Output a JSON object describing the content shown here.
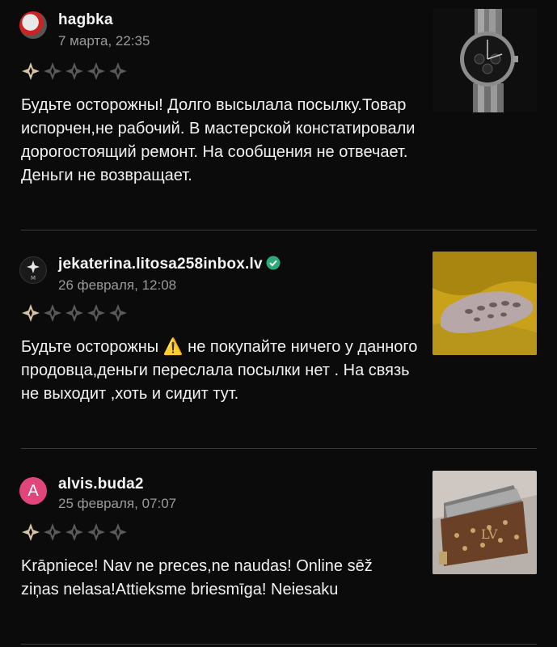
{
  "reviews": [
    {
      "username": "hagbka",
      "date": "7 марта, 22:35",
      "rating": 1,
      "text": "Будьте осторожны! Долго высылала посылку.Товар испорчен,не рабочий. В мастерской констатировали дорогостоящий ремонт. На сообщения не отвечает. Деньги не возвращает.",
      "photo": "watch-photo"
    },
    {
      "username": "jekaterina.litosa258inbox.lv",
      "date": "26 февраля, 12:08",
      "rating": 1,
      "text": "Будьте осторожны ⚠️ не покупайте ничего у данного продовца,деньги переслала посылки нет . На связь не выходит ,хоть и сидит тут.",
      "photo": "sneaker-photo",
      "verified": true
    },
    {
      "username": "alvis.buda2",
      "avatar_letter": "A",
      "date": "25 февраля, 07:07",
      "rating": 1,
      "text": "Krāpniece! Nav ne preces,ne  naudas!  Online sēž ziņas nelasa!Attieksme  briesmīga! Neiesaku",
      "photo": "wallet-photo"
    }
  ],
  "colors": {
    "star_filled": "#d7c2a6",
    "star_empty": "#5a5a5a",
    "verified": "#2fa87a",
    "avatar_letter_bg": "#e0457b"
  }
}
